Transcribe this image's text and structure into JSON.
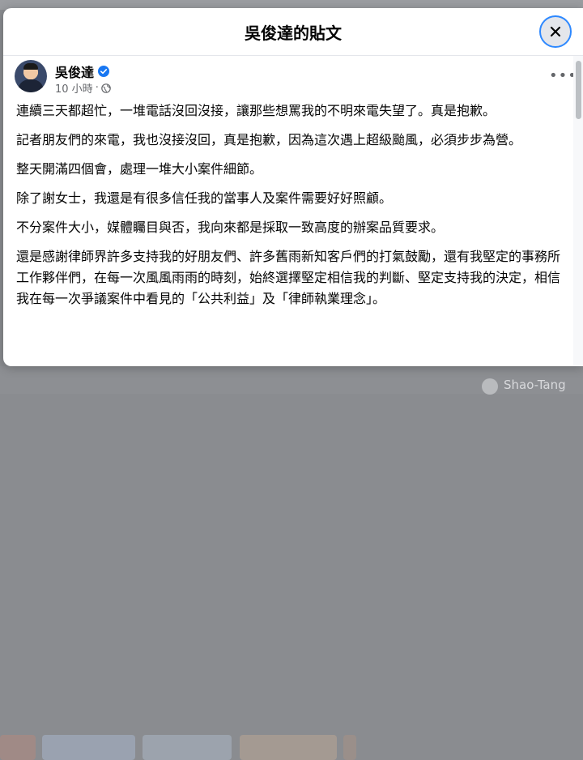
{
  "modal": {
    "title": "吳俊達的貼文"
  },
  "post": {
    "author": "吳俊達",
    "time": "10 小時",
    "separator": "·",
    "more": "•••",
    "paragraphs": [
      "連續三天都超忙，一堆電話沒回沒接，讓那些想罵我的不明來電失望了。真是抱歉。",
      "記者朋友們的來電，我也沒接沒回，真是抱歉，因為這次遇上超級颱風，必須步步為營。",
      "整天開滿四個會，處理一堆大小案件細節。",
      "除了謝女士，我還是有很多信任我的當事人及案件需要好好照顧。",
      "不分案件大小，媒體矚目與否，我向來都是採取一致高度的辦案品質要求。",
      "還是感謝律師界許多支持我的好朋友們、許多舊雨新知客戶們的打氣鼓勵，還有我堅定的事務所工作夥伴們，在每一次風風雨雨的時刻，始終選擇堅定相信我的判斷、堅定支持我的決定，相信我在每一次爭議案件中看見的「公共利益」及「律師執業理念」。"
    ]
  },
  "background": {
    "commenter_name": "Shao-Tang"
  },
  "icons": {
    "close": "close-icon",
    "verified": "verified-badge-icon",
    "privacy": "globe-icon",
    "more": "more-options-icon"
  },
  "colors": {
    "accent": "#1877f2",
    "focus_ring": "#2d88ff",
    "text": "#050505",
    "secondary_text": "#65676b"
  }
}
